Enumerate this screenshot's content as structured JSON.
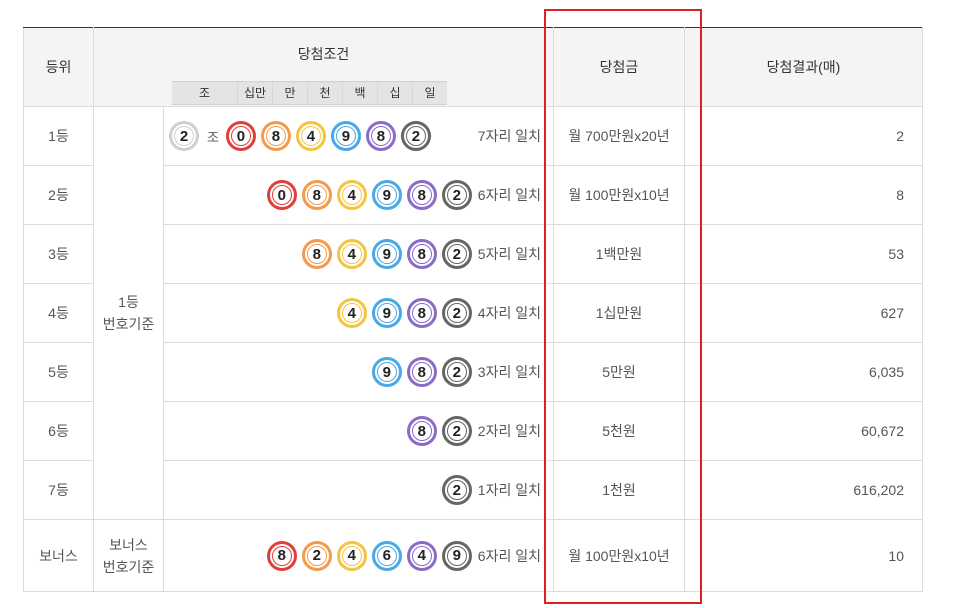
{
  "header": {
    "rank": "등위",
    "condition": "당첨조건",
    "place_labels": [
      "조",
      "십만",
      "만",
      "천",
      "백",
      "십",
      "일"
    ],
    "prize": "당첨금",
    "result": "당첨결과(매)"
  },
  "basis_first": [
    "1등",
    "번호기준"
  ],
  "basis_bonus": [
    "보너스",
    "번호기준"
  ],
  "rows": [
    {
      "rank": "1등",
      "jo": "2",
      "jo_label": "조",
      "balls": [
        "0",
        "8",
        "4",
        "9",
        "8",
        "2"
      ],
      "match": "7자리 일치",
      "prize": "월 700만원x20년",
      "count": "2"
    },
    {
      "rank": "2등",
      "balls": [
        "0",
        "8",
        "4",
        "9",
        "8",
        "2"
      ],
      "match": "6자리 일치",
      "prize": "월 100만원x10년",
      "count": "8"
    },
    {
      "rank": "3등",
      "balls": [
        "8",
        "4",
        "9",
        "8",
        "2"
      ],
      "match": "5자리 일치",
      "prize": "1백만원",
      "count": "53"
    },
    {
      "rank": "4등",
      "balls": [
        "4",
        "9",
        "8",
        "2"
      ],
      "match": "4자리 일치",
      "prize": "1십만원",
      "count": "627"
    },
    {
      "rank": "5등",
      "balls": [
        "9",
        "8",
        "2"
      ],
      "match": "3자리 일치",
      "prize": "5만원",
      "count": "6,035"
    },
    {
      "rank": "6등",
      "balls": [
        "8",
        "2"
      ],
      "match": "2자리 일치",
      "prize": "5천원",
      "count": "60,672"
    },
    {
      "rank": "7등",
      "balls": [
        "2"
      ],
      "match": "1자리 일치",
      "prize": "1천원",
      "count": "616,202"
    }
  ],
  "bonus": {
    "rank": "보너스",
    "balls": [
      "8",
      "2",
      "4",
      "6",
      "4",
      "9"
    ],
    "match": "6자리 일치",
    "prize": "월 100만원x10년",
    "count": "10"
  },
  "colors": {
    "highlight_box": "#e02020",
    "prize_text": "#c2410c",
    "ball_jo": "#cfcfcf",
    "ball_sipman": "#e0403a",
    "ball_man": "#f39b4a",
    "ball_cheon": "#f5c542",
    "ball_baek": "#48a9e6",
    "ball_sip": "#8a6bc7",
    "ball_il": "#666666"
  }
}
